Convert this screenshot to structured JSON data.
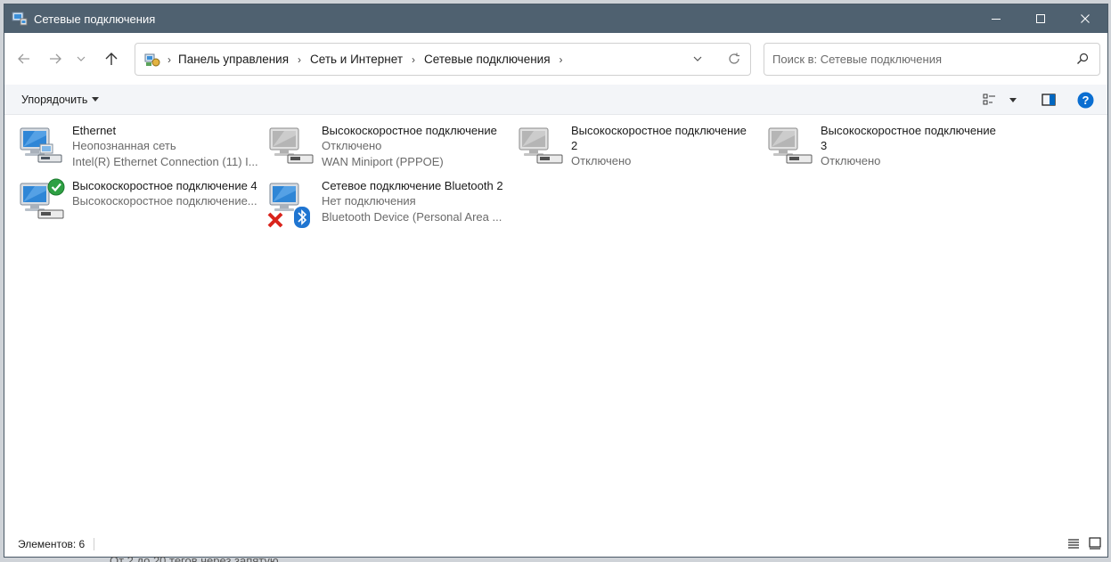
{
  "window": {
    "title": "Сетевые подключения"
  },
  "address": {
    "breadcrumbs": [
      "Панель управления",
      "Сеть и Интернет",
      "Сетевые подключения"
    ]
  },
  "search": {
    "placeholder": "Поиск в: Сетевые подключения"
  },
  "toolbar": {
    "organize_label": "Упорядочить"
  },
  "connections": [
    {
      "name": "Ethernet",
      "line2": "Неопознанная сеть",
      "line3": "Intel(R) Ethernet Connection (11) I...",
      "icon": "ethernet-network-icon"
    },
    {
      "name": "Высокоскоростное подключение",
      "line2": "Отключено",
      "line3": "WAN Miniport (PPPOE)",
      "icon": "broadband-disabled-icon"
    },
    {
      "name": "Высокоскоростное подключение 2",
      "line2": "Отключено",
      "icon": "broadband-disabled-icon"
    },
    {
      "name": "Высокоскоростное подключение 3",
      "line2": "Отключено",
      "icon": "broadband-disabled-icon"
    },
    {
      "name": "Высокоскоростное подключение 4",
      "line2": "Высокоскоростное подключение...",
      "icon": "broadband-connected-icon"
    },
    {
      "name": "Сетевое подключение Bluetooth 2",
      "line2": "Нет подключения",
      "line3": "Bluetooth Device (Personal Area ...",
      "icon": "bluetooth-network-icon"
    }
  ],
  "status": {
    "items_count": "Элементов: 6"
  },
  "background_text": "От 2 до 20 тегов через запятую",
  "colors": {
    "titlebar": "#4f6170",
    "accent": "#0067c0",
    "ok_green": "#2ea043",
    "error_red": "#d9241c"
  }
}
